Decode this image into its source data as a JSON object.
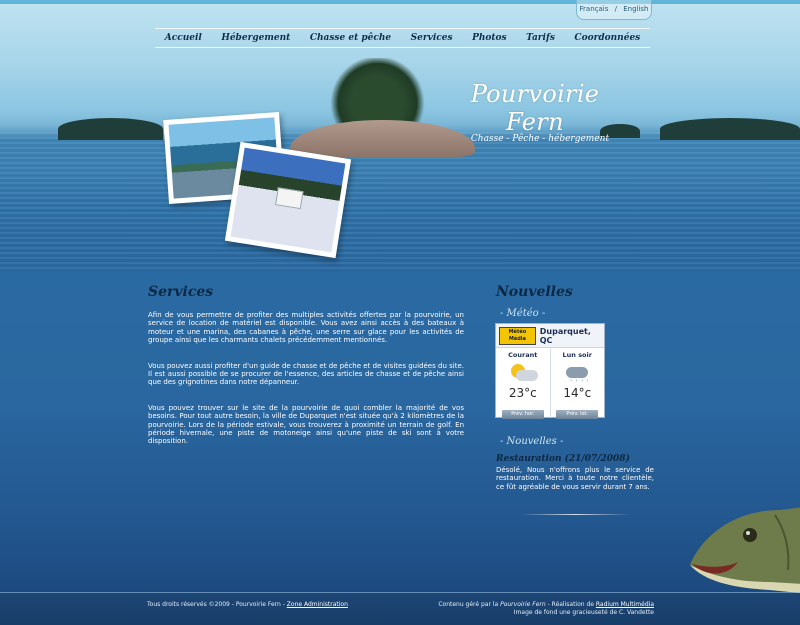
{
  "lang": {
    "fr": "Français",
    "sep": "/",
    "en": "English"
  },
  "nav": [
    "Accueil",
    "Hébergement",
    "Chasse et pêche",
    "Services",
    "Photos",
    "Tarifs",
    "Coordonnées"
  ],
  "brand": {
    "title": "Pourvoirie Fern",
    "subtitle": "Chasse - Pêche - hébergement"
  },
  "services": {
    "title": "Services",
    "paragraphs": [
      "Afin de vous permettre de profiter des multiples activités offertes par la pourvoirie, un service de location de matériel est disponible. Vous avez ainsi accès à des bateaux à moteur et une marina, des cabanes à pêche, une serre sur glace pour les activités de groupe ainsi que les charmants chalets précédemment mentionnés.",
      "Vous pouvez aussi profiter d'un guide de chasse et de pêche et de visites guidées du site. Il est aussi possible de se procurer de l'essence, des articles de chasse et de pêche ainsi que des grignotines dans notre dépanneur.",
      "Vous pouvez trouver sur le site de la pourvoirie de quoi combler la majorité de vos besoins. Pour tout autre besoin, la ville de Duparquet n'est située qu'à 2 kilomètres de la pourvoirie. Lors de la période estivale, vous trouverez à proximité un terrain de golf. En période hivernale, une piste de motoneige ainsi qu'une piste de ski sont à votre disposition."
    ]
  },
  "news": {
    "title": "Nouvelles",
    "meteo_label": "- Météo -",
    "weather": {
      "logo": "Météo Média",
      "city": "Duparquet, QC",
      "now_label": "Courant",
      "now_temp": "23°c",
      "now_button": "Prév. hor.",
      "night_label": "Lun soir",
      "night_temp": "14°c",
      "night_button": "Prév. lot."
    },
    "nouvelles_label": "- Nouvelles -",
    "item_title": "Restauration (21/07/2008)",
    "item_body": "Désolé, Nous n'offrons plus le service de restauration. Merci à toute notre clientèle, ce fût agréable de vous servir durant 7 ans."
  },
  "footer": {
    "copyright": "Tous droits réservés ©2009 - Pourvoirie Fern - ",
    "admin_link": "Zone Administration",
    "managed_prefix": "Contenu géré par la ",
    "managed_name": "Pourvoirie Fern",
    "managed_mid": " - Réalisation de ",
    "agency_link": "Radium Multimédia",
    "credit": "Image de fond une gracieuseté de C. Vandette"
  }
}
